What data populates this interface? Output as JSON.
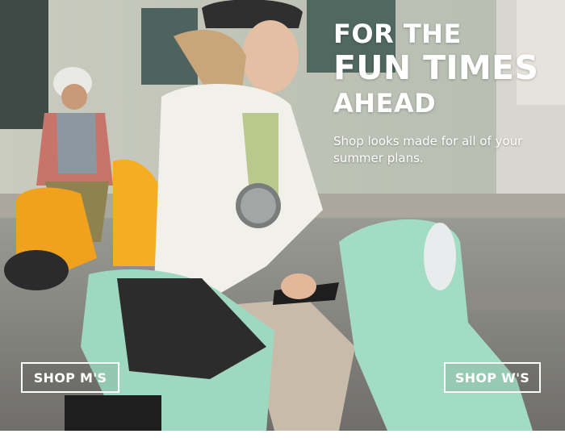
{
  "hero": {
    "headline_line1": "FOR THE",
    "headline_line2": "FUN TIMES",
    "headline_line3": "AHEAD",
    "subtext": "Shop looks made for all of your summer plans."
  },
  "buttons": {
    "shop_mens": "SHOP M'S",
    "shop_womens": "SHOP W'S"
  },
  "colors": {
    "text": "#ffffff",
    "scooter_front": "#9fd8c0",
    "scooter_back": "#f2a623"
  }
}
